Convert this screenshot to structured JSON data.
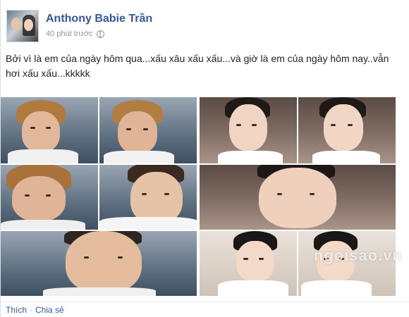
{
  "post": {
    "author": "Anthony Babie Trần",
    "time": "40 phút trước",
    "privacy_icon": "globe-icon",
    "text": "Bởi vì là em của ngày hôm qua...xấu xâu xấu xấu...và giờ là em của ngày hôm nay..vẫn hơi xấu xấu...kkkkk"
  },
  "photos": {
    "watermark": "ngoisao.vn"
  },
  "actions": {
    "like": "Thích",
    "separator": "·",
    "share": "Chia sẻ"
  }
}
